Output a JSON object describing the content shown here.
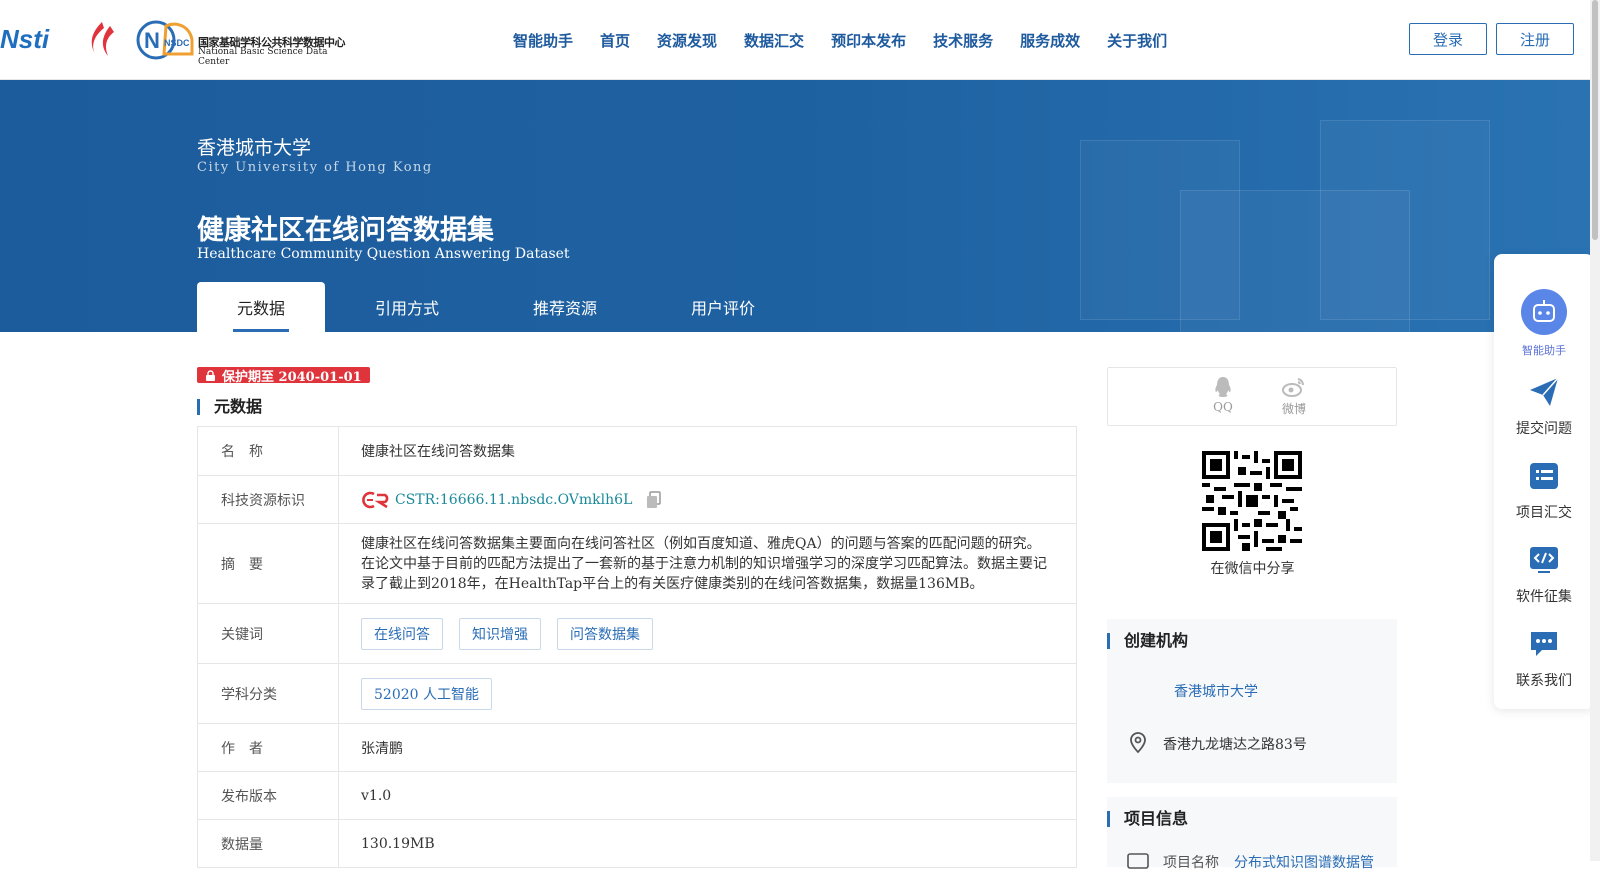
{
  "header": {
    "logo_text": "Nsti",
    "logo_nsdc_cn": "国家基础学科公共科学数据中心",
    "logo_nsdc_en": "National Basic Science Data Center",
    "logo_nsdc_abbr": "NSDC",
    "nav": [
      "智能助手",
      "首页",
      "资源发现",
      "数据汇交",
      "预印本发布",
      "技术服务",
      "服务成效",
      "关于我们"
    ],
    "login_label": "登录",
    "register_label": "注册"
  },
  "banner": {
    "institution_cn": "香港城市大学",
    "institution_en": "City University of Hong Kong",
    "title_cn": "健康社区在线问答数据集",
    "title_en": "Healthcare Community Question Answering Dataset",
    "tabs": [
      "元数据",
      "引用方式",
      "推荐资源",
      "用户评价"
    ]
  },
  "protection_badge": "保护期至 2040-01-01",
  "metadata": {
    "section_title": "元数据",
    "labels": {
      "name": "名　称",
      "cstr": "科技资源标识",
      "abstract": "摘　要",
      "keywords": "关键词",
      "subject": "学科分类",
      "author": "作　者",
      "version": "发布版本",
      "size": "数据量"
    },
    "name": "健康社区在线问答数据集",
    "cstr_logo": "CSTR",
    "cstr": "CSTR:16666.11.nbsdc.OVmklh6L",
    "abstract": "健康社区在线问答数据集主要面向在线问答社区（例如百度知道、雅虎QA）的问题与答案的匹配问题的研究。在论文中基于目前的匹配方法提出了一套新的基于注意力机制的知识增强学习的深度学习匹配算法。数据主要记录了截止到2018年，在HealthTap平台上的有关医疗健康类别的在线问答数据集，数据量136MB。",
    "keywords": [
      "在线问答",
      "知识增强",
      "问答数据集"
    ],
    "subject": "52020 人工智能",
    "author": "张清鹏",
    "version": "v1.0",
    "size": "130.19MB"
  },
  "share": {
    "qq_label": "QQ",
    "weibo_label": "微博",
    "wechat_label": "在微信中分享"
  },
  "creator": {
    "section_title": "创建机构",
    "institution": "香港城市大学",
    "address": "香港九龙塘达之路83号"
  },
  "project": {
    "section_title": "项目信息",
    "name_label": "项目名称",
    "name_value": "分布式知识图谱数据管"
  },
  "side_rail": {
    "items": [
      "智能助手",
      "提交问题",
      "项目汇交",
      "软件征集",
      "联系我们"
    ]
  },
  "colors": {
    "primary": "#2a6db5",
    "banner": "#1e61a1",
    "badge": "#e0343c"
  }
}
